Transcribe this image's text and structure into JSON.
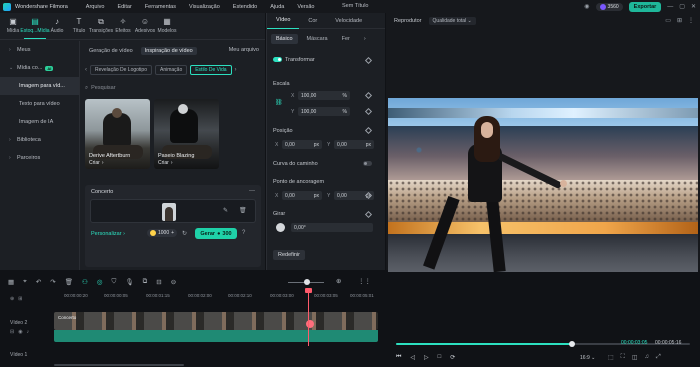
{
  "titlebar": {
    "app_name": "Wondershare Filmora",
    "menu": [
      "Arquivo",
      "Editar",
      "Ferramentas",
      "Visualização",
      "Estendido",
      "Ajuda",
      "Versão"
    ],
    "project_title": "Sem Título",
    "credits": "3560",
    "export_label": "Exportar"
  },
  "toolbar": {
    "tools": [
      {
        "label": "Mídia",
        "icon": "media-icon"
      },
      {
        "label": "Estoq...Mídia",
        "icon": "stock-media-icon"
      },
      {
        "label": "Áudio",
        "icon": "audio-icon"
      },
      {
        "label": "Título",
        "icon": "title-icon"
      },
      {
        "label": "Transições",
        "icon": "transitions-icon"
      },
      {
        "label": "Efeitos",
        "icon": "effects-icon"
      },
      {
        "label": "Adesivos",
        "icon": "stickers-icon"
      },
      {
        "label": "Modelos",
        "icon": "templates-icon"
      }
    ]
  },
  "sidebar": {
    "items": [
      {
        "label": "Meus",
        "arrow": "›"
      },
      {
        "label": "Mídia co...",
        "arrow": "⌄",
        "tag": "AI"
      },
      {
        "label": "Imagem para víd..."
      },
      {
        "label": "Texto para vídeo"
      },
      {
        "label": "Imagem de IA"
      },
      {
        "label": "Biblioteca",
        "arrow": "›"
      },
      {
        "label": "Parceiros",
        "arrow": "›"
      }
    ]
  },
  "content": {
    "tabs": [
      "Geração de vídeo",
      "Inspiração de vídeo"
    ],
    "my_files": "Meu arquivo",
    "filters": [
      "Revelação De Logotipo",
      "Animação",
      "Estilo De Vida"
    ],
    "search_placeholder": "Pesquisar",
    "thumbs": [
      {
        "title": "Derive Aftertburn",
        "create": "Criar"
      },
      {
        "title": "Paseio Blazing",
        "create": "Criar"
      }
    ],
    "concerto": {
      "title": "Concerto",
      "personalize": "Personalizar",
      "quantity": "1000",
      "generate_label": "Gerar",
      "generate_cost": "300"
    }
  },
  "props": {
    "tabs": [
      "Vídeo",
      "Cor",
      "Velocidade"
    ],
    "subtabs": [
      "Básico",
      "Máscara",
      "Fer"
    ],
    "transform_label": "Transformar",
    "scale_label": "Escala",
    "scale_x": "100,00",
    "scale_y": "100,00",
    "percent": "%",
    "position_label": "Posição",
    "pos_x": "0,00",
    "pos_y": "0,00",
    "unit_px": "px",
    "path_curve_label": "Curva do caminho",
    "anchor_label": "Ponto de ancoragem",
    "anchor_x": "0,00",
    "anchor_y": "0,00",
    "rotate_label": "Girar",
    "rotate_value": "0,00°",
    "reset_label": "Redefinir",
    "x_label": "X",
    "y_label": "Y"
  },
  "preview": {
    "label": "Reprodutor",
    "quality": "Qualidade total",
    "time_current": "00:00:03:05",
    "time_total": "00:00:05:16",
    "progress": 0.6,
    "ratio": "16:9"
  },
  "timeline": {
    "ticks": [
      "00:00:00:20",
      "00:00:00:05",
      "00:00:01:15",
      "00:00:02:00",
      "00:00:02:10",
      "00:00:03:00",
      "00:00:03:05",
      "00:00:05:01"
    ],
    "tracks": [
      "Vídeo 2",
      "Vídeo 1"
    ],
    "clip_title": "Concerto"
  }
}
